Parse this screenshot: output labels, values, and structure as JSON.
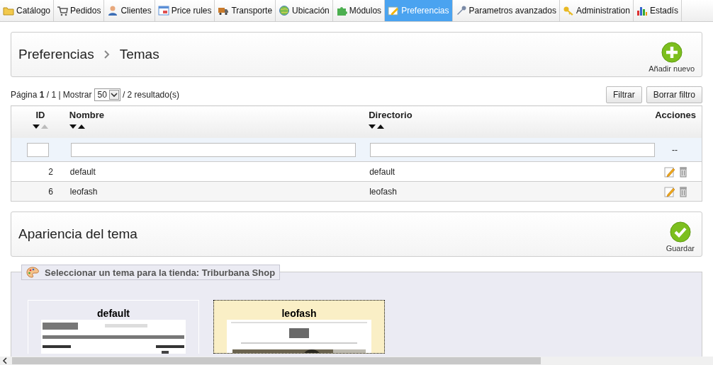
{
  "tabs": [
    {
      "label": "Catálogo",
      "selected": false
    },
    {
      "label": "Pedidos",
      "selected": false
    },
    {
      "label": "Clientes",
      "selected": false
    },
    {
      "label": "Price rules",
      "selected": false
    },
    {
      "label": "Transporte",
      "selected": false
    },
    {
      "label": "Ubicación",
      "selected": false
    },
    {
      "label": "Módulos",
      "selected": false
    },
    {
      "label": "Preferencias",
      "selected": true
    },
    {
      "label": "Parametros avanzados",
      "selected": false
    },
    {
      "label": "Administration",
      "selected": false
    },
    {
      "label": "Estadís",
      "selected": false
    }
  ],
  "toolbar": {
    "breadcrumb": [
      "Preferencias",
      "Temas"
    ],
    "action": "Añadir nuevo"
  },
  "pagination": {
    "page_info": "Página **1** / 1 | Mostrar",
    "per_page": "50",
    "results": "/ 2 resultado(s)"
  },
  "filter_buttons": [
    "Filtrar",
    "Borrar filtro"
  ],
  "table": {
    "columns": [
      {
        "label": "ID",
        "sort": {
          "up_dimmed": true
        }
      },
      {
        "label": "Nombre",
        "sort": {
          "up_dimmed": false
        }
      },
      {
        "label": "Directorio",
        "sort": {
          "up_dimmed": false
        }
      },
      {
        "label": "Acciones"
      }
    ],
    "filter_actions": "--",
    "rows": [
      {
        "id": "2",
        "name": "default",
        "directory": "default"
      },
      {
        "id": "6",
        "name": "leofash",
        "directory": "leofash"
      }
    ]
  },
  "appearance": {
    "title": "Apariencia del tema",
    "action": "Guardar",
    "legend": "Seleccionar un tema para la tienda: Triburbana Shop",
    "themes": [
      {
        "name": "default",
        "selected": false
      },
      {
        "name": "leofash",
        "selected": true
      }
    ]
  }
}
